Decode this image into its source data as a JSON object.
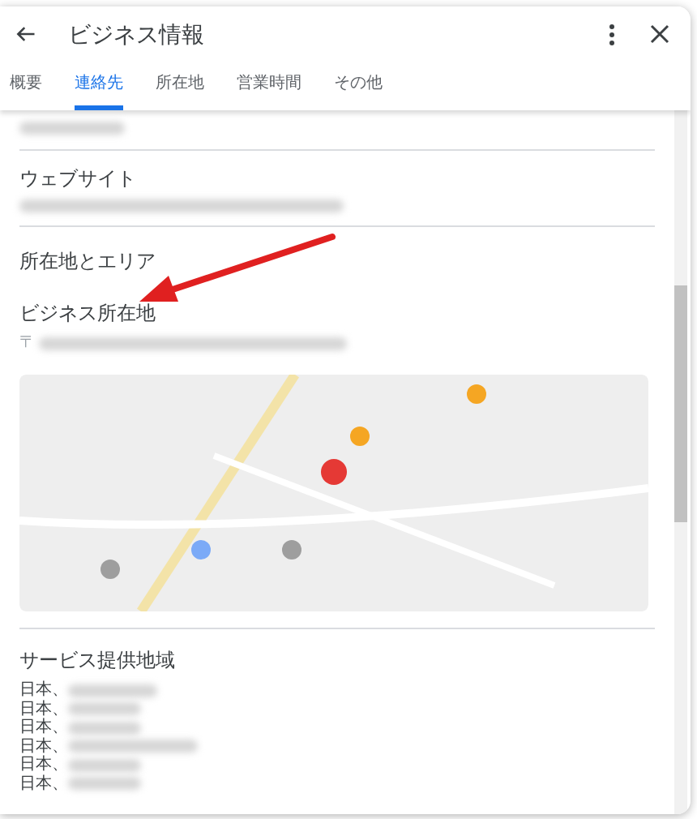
{
  "header": {
    "title": "ビジネス情報"
  },
  "tabs": [
    {
      "label": "概要",
      "selected": false
    },
    {
      "label": "連絡先",
      "selected": true
    },
    {
      "label": "所在地",
      "selected": false
    },
    {
      "label": "営業時間",
      "selected": false
    },
    {
      "label": "その他",
      "selected": false
    }
  ],
  "website": {
    "heading": "ウェブサイト"
  },
  "location": {
    "heading": "所在地とエリア",
    "address_label": "ビジネス所在地",
    "postal_mark": "〒"
  },
  "service_area": {
    "heading": "サービス提供地域",
    "items": [
      "日本、",
      "日本、",
      "日本、",
      "日本、",
      "日本、",
      "日本、"
    ]
  }
}
